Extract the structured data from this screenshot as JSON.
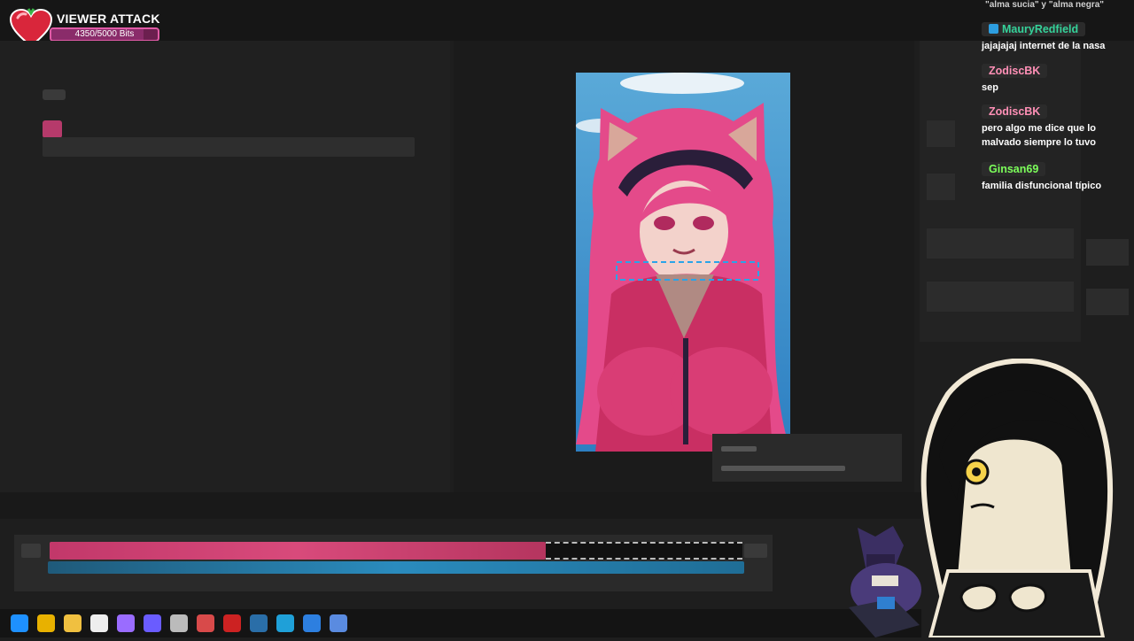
{
  "overlay": {
    "title": "VIEWER ATTACK",
    "bits_text": "4350/5000 Bits",
    "bits_progress": 0.87,
    "accent": "#e05aa6"
  },
  "chat": {
    "top_fragment": "\"alma sucia\" y \"alma negra\"",
    "messages": [
      {
        "user": "MauryRedfield",
        "color": "#35d29a",
        "badge": "twitch-prime-icon",
        "text": "jajajajaj internet de la nasa"
      },
      {
        "user": "ZodiscBK",
        "color": "#ff8fb6",
        "text": "sep"
      },
      {
        "user": "ZodiscBK",
        "color": "#ff8fb6",
        "text": "pero algo me dice que lo malvado siempre lo tuvo"
      },
      {
        "user": "Ginsan69",
        "color": "#7cff5a",
        "text": "familia disfuncional típico"
      }
    ]
  },
  "taskbar": {
    "icons": [
      "windows-icon",
      "chrome-icon",
      "folder-icon",
      "app-icon",
      "paint-icon",
      "obs-icon",
      "discord-icon",
      "game-icon",
      "record-icon",
      "steam-icon",
      "browser-icon",
      "store-icon",
      "settings-icon"
    ]
  },
  "colors": {
    "pink_track": "#d84a7b",
    "blue_track": "#2a8bbd"
  }
}
